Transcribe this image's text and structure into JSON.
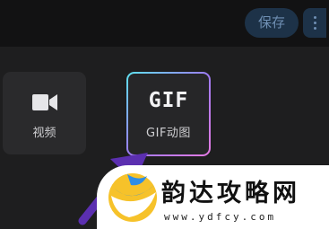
{
  "toolbar": {
    "save_label": "保存"
  },
  "tiles": [
    {
      "label": "视频",
      "icon": "video-camera-icon"
    },
    {
      "glyph": "GIF",
      "label": "GIF动图",
      "icon": "gif-icon"
    }
  ],
  "watermark": {
    "name": "韵达攻略网",
    "url": "www.ydfcy.com"
  },
  "colors": {
    "accent_button": "#1d3248",
    "gif_border_start": "#5ee3ef",
    "gif_border_end": "#e57ae2",
    "arrow": "#5b2fb0"
  }
}
